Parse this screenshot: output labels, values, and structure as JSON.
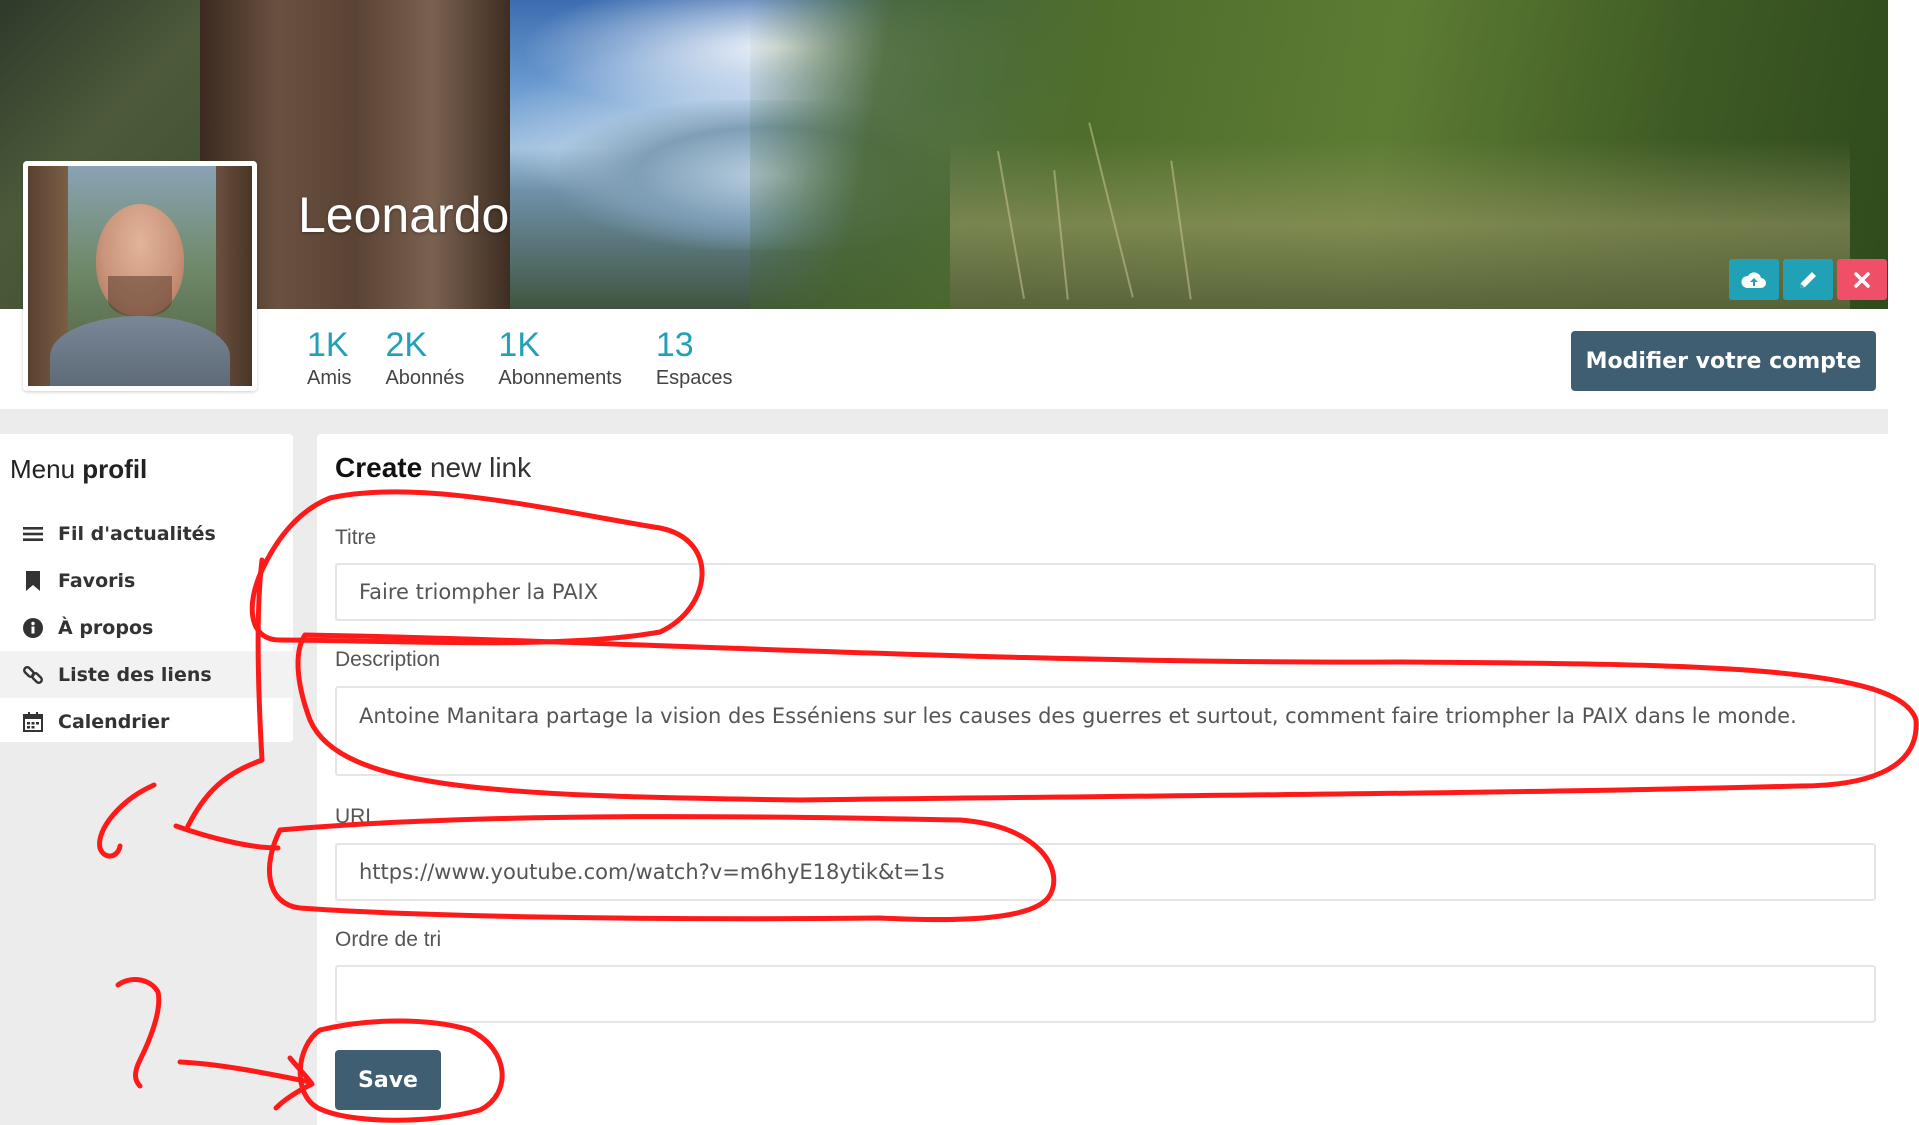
{
  "profile": {
    "name": "Leonardo"
  },
  "banner_actions": [
    {
      "icon": "cloud-upload-icon",
      "color": "#21a1b5"
    },
    {
      "icon": "pencil-icon",
      "color": "#21a1b5"
    },
    {
      "icon": "close-icon",
      "color": "#ef5067"
    }
  ],
  "stats": [
    {
      "value": "1K",
      "label": "Amis"
    },
    {
      "value": "2K",
      "label": "Abonnés"
    },
    {
      "value": "1K",
      "label": "Abonnements"
    },
    {
      "value": "13",
      "label": "Espaces"
    }
  ],
  "account_button": "Modifier votre compte",
  "side_menu": {
    "title_light": "Menu",
    "title_bold": "profil",
    "items": [
      {
        "label": "Fil d'actualités",
        "icon": "list-icon",
        "active": false
      },
      {
        "label": "Favoris",
        "icon": "bookmark-icon",
        "active": false
      },
      {
        "label": "À propos",
        "icon": "info-icon",
        "active": false
      },
      {
        "label": "Liste des liens",
        "icon": "link-icon",
        "active": true
      },
      {
        "label": "Calendrier",
        "icon": "calendar-icon",
        "active": false
      }
    ]
  },
  "form": {
    "title_bold": "Create",
    "title_light": "new link",
    "title_label": "Titre",
    "title_value": "Faire triompher la PAIX",
    "description_label": "Description",
    "description_value": "Antoine Manitara partage la vision des Esséniens sur les causes des guerres et surtout, comment faire triompher la PAIX dans le monde.",
    "url_label": "URL",
    "url_value": "https://www.youtube.com/watch?v=m6hyE18ytik&t=1s",
    "order_label": "Ordre de tri",
    "order_value": "",
    "save_label": "Save"
  },
  "colors": {
    "accent": "#21a1b5",
    "danger": "#ef5067",
    "primary_button": "#3f5e72",
    "annotation": "#ff0000"
  }
}
